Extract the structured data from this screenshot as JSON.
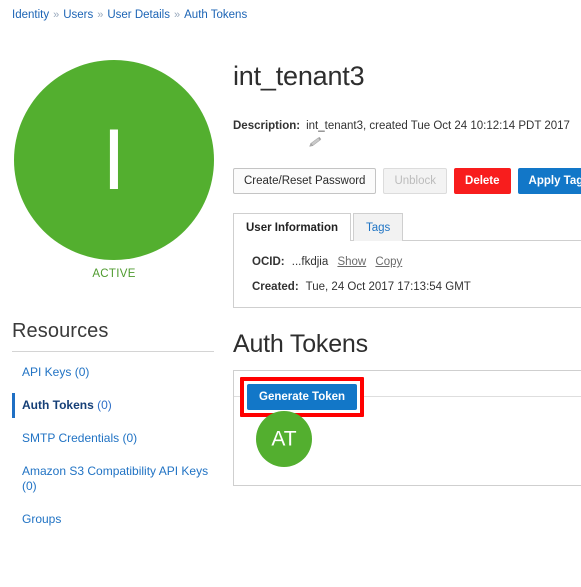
{
  "breadcrumb": {
    "separator": "»",
    "items": [
      "Identity",
      "Users",
      "User Details",
      "Auth Tokens"
    ]
  },
  "user": {
    "avatar_initial": "I",
    "status": "ACTIVE",
    "status_color": "#4f9b2f",
    "avatar_color": "#53af2f",
    "title": "int_tenant3",
    "description_label": "Description:",
    "description_value": "int_tenant3, created Tue Oct 24 10:12:14 PDT 2017",
    "edit_icon": "pencil-icon"
  },
  "actions": {
    "create_reset_password": "Create/Reset Password",
    "unblock": "Unblock",
    "delete": "Delete",
    "apply_tags": "Apply Tag(s)",
    "delete_color": "#f81d1d",
    "primary_color": "#1277c8"
  },
  "tabs": {
    "items": [
      {
        "label": "User Information",
        "active": true
      },
      {
        "label": "Tags",
        "active": false
      }
    ],
    "details": [
      {
        "key": "OCID:",
        "value": "...fkdjia",
        "links": [
          "Show",
          "Copy"
        ]
      },
      {
        "key": "Created:",
        "value": "Tue, 24 Oct 2017 17:13:54 GMT",
        "links": []
      }
    ]
  },
  "sidebar": {
    "title": "Resources",
    "items": [
      {
        "label": "API Keys",
        "count": "(0)",
        "active": false
      },
      {
        "label": "Auth Tokens",
        "count": "(0)",
        "active": true
      },
      {
        "label": "SMTP Credentials",
        "count": "(0)",
        "active": false
      },
      {
        "label": "Amazon S3 Compatibility API Keys",
        "count": "(0)",
        "active": false
      },
      {
        "label": "Groups",
        "count": "",
        "active": false
      }
    ]
  },
  "tokens_section": {
    "title": "Auth Tokens",
    "generate_button": "Generate Token",
    "highlight_color": "#ff0000",
    "token_avatar_initials": "AT",
    "token_avatar_color": "#53af2f"
  }
}
